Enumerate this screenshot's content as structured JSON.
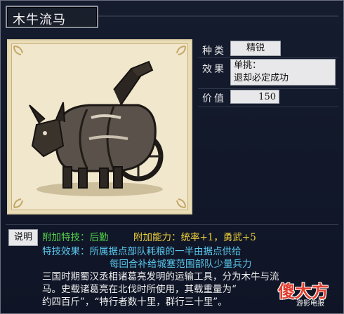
{
  "window": {
    "title": "木牛流马"
  },
  "item": {
    "type_label": "种类",
    "type_value": "精锐",
    "effect_label": "效果",
    "effect_lines": [
      "单挑：",
      "退却必定成功"
    ],
    "price_label": "价值",
    "price_value": "150"
  },
  "description": {
    "label": "说明",
    "skill_title": "附加特技：后勤",
    "ability_title": "附加能力：统率+1，勇武+5",
    "effect_line1": "特技效果：所属据点部队耗粮的一半由据点供给",
    "effect_line2": "每回合补给城塞范围部队少量兵力",
    "text_line1": "三国时期蜀汉丞相诸葛亮发明的运输工具，分为木牛与流",
    "text_line2": "马。史载诸葛亮在北伐时所使用，其载重量为“",
    "text_line3": "约四百斤”，“特行者数十里，群行三十里”。"
  },
  "watermark": {
    "big": "傻大方",
    "small": "游影电报"
  },
  "colors": {
    "skill": "#52d04a",
    "ability": "#f0d23a",
    "effect": "#5ac8ee"
  }
}
